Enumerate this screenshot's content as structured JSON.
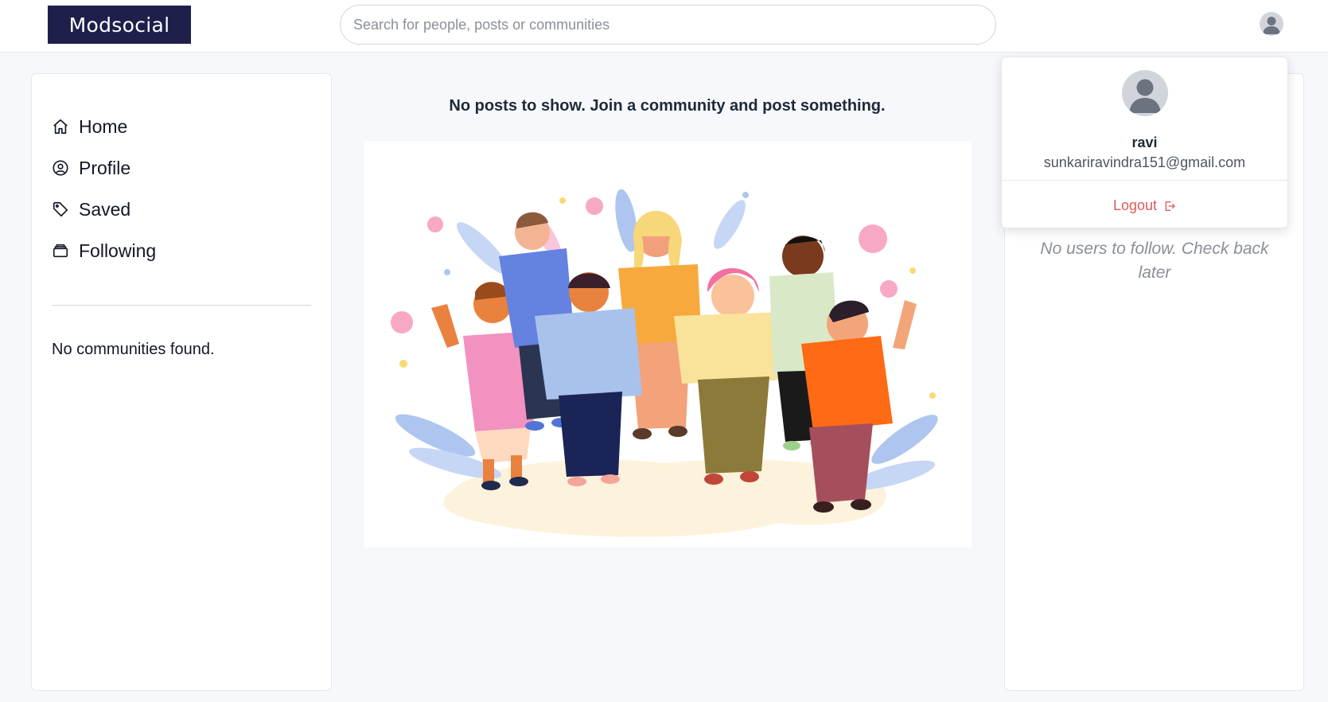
{
  "header": {
    "logo": "Modsocial",
    "search_placeholder": "Search for people, posts or communities"
  },
  "sidebar": {
    "items": [
      {
        "label": "Home",
        "icon": "home-icon"
      },
      {
        "label": "Profile",
        "icon": "user-circle-icon"
      },
      {
        "label": "Saved",
        "icon": "tag-icon"
      },
      {
        "label": "Following",
        "icon": "archive-icon"
      }
    ],
    "no_communities": "No communities found."
  },
  "main": {
    "empty_message": "No posts to show. Join a community and post something."
  },
  "right": {
    "no_users": "No users to follow. Check back later"
  },
  "dropdown": {
    "name": "ravi",
    "email": "sunkariravindra151@gmail.com",
    "logout_label": "Logout"
  },
  "colors": {
    "brand": "#1e1f4b",
    "logout": "#e15a5a",
    "background": "#f6f8fb"
  }
}
